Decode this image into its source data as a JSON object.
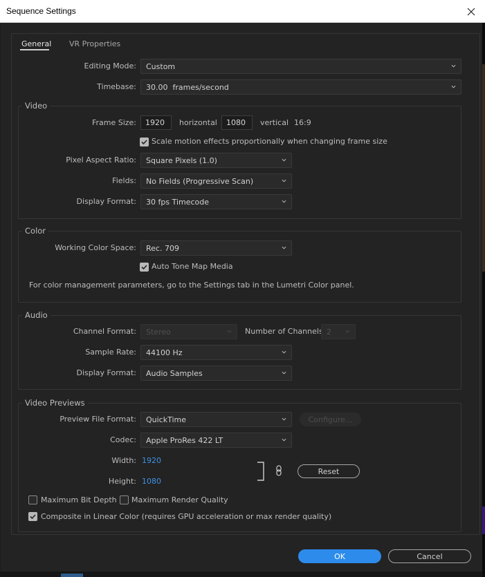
{
  "window": {
    "title": "Sequence Settings"
  },
  "tabs": [
    {
      "label": "General",
      "active": true
    },
    {
      "label": "VR Properties",
      "active": false
    }
  ],
  "general": {
    "editing_mode": {
      "label": "Editing Mode:",
      "value": "Custom"
    },
    "timebase": {
      "label": "Timebase:",
      "value": "30.00  frames/second"
    }
  },
  "video": {
    "group_label": "Video",
    "frame_size": {
      "label": "Frame Size:",
      "horizontal": "1920",
      "horizontal_label": "horizontal",
      "vertical": "1080",
      "vertical_label": "vertical",
      "aspect": "16:9"
    },
    "scale_motion": {
      "label": "Scale motion effects proportionally when changing frame size",
      "checked": true
    },
    "pixel_aspect_ratio": {
      "label": "Pixel Aspect Ratio:",
      "value": "Square Pixels (1.0)"
    },
    "fields": {
      "label": "Fields:",
      "value": "No Fields (Progressive Scan)"
    },
    "display_format": {
      "label": "Display Format:",
      "value": "30 fps Timecode"
    }
  },
  "color": {
    "group_label": "Color",
    "working_color_space": {
      "label": "Working Color Space:",
      "value": "Rec. 709"
    },
    "auto_tone_map": {
      "label": "Auto Tone Map Media",
      "checked": true
    },
    "info": "For color management parameters, go to the Settings tab in the Lumetri Color panel."
  },
  "audio": {
    "group_label": "Audio",
    "channel_format": {
      "label": "Channel Format:",
      "value": "Stereo",
      "disabled": true
    },
    "number_of_channels": {
      "label": "Number of Channels:",
      "value": "2",
      "disabled": true
    },
    "sample_rate": {
      "label": "Sample Rate:",
      "value": "44100 Hz"
    },
    "display_format": {
      "label": "Display Format:",
      "value": "Audio Samples"
    }
  },
  "video_previews": {
    "group_label": "Video Previews",
    "preview_file_format": {
      "label": "Preview File Format:",
      "value": "QuickTime"
    },
    "configure_label": "Configure...",
    "codec": {
      "label": "Codec:",
      "value": "Apple ProRes 422 LT"
    },
    "width": {
      "label": "Width:",
      "value": "1920"
    },
    "height": {
      "label": "Height:",
      "value": "1080"
    },
    "reset_label": "Reset",
    "max_bit_depth": {
      "label": "Maximum Bit Depth",
      "checked": false
    },
    "max_render_quality": {
      "label": "Maximum Render Quality",
      "checked": false
    },
    "composite_linear": {
      "label": "Composite in Linear Color (requires GPU acceleration or max render quality)",
      "checked": true
    }
  },
  "buttons": {
    "ok": "OK",
    "cancel": "Cancel"
  },
  "colors": {
    "accent": "#2d8ceb",
    "value_blue": "#3f91e6",
    "background": "#232323"
  }
}
